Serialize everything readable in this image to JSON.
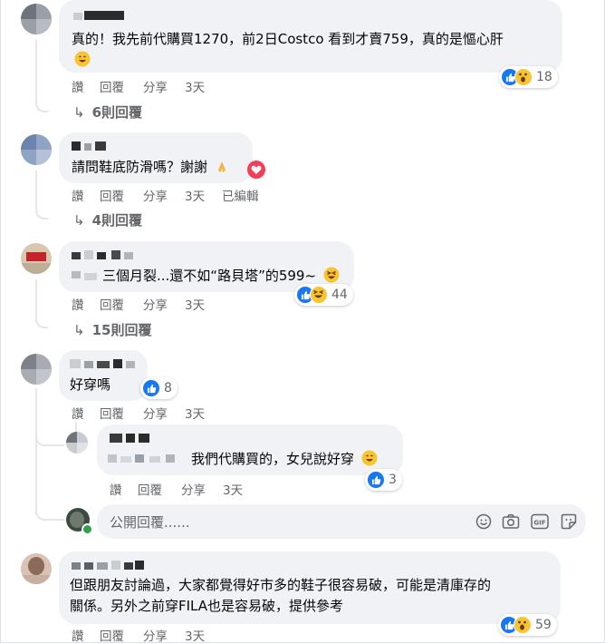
{
  "comments": [
    {
      "text_lines": [
        "真的！我先前代購買1270，前2日Costco 看到才賣759，真的是慪心肝"
      ],
      "has_emoji_line": true,
      "actions": {
        "like": "讚",
        "reply": "回覆",
        "share": "分享",
        "time": "3天"
      },
      "reactions": {
        "icons": [
          "like-icon",
          "wow-icon"
        ],
        "count": "18"
      },
      "replies_label": "6則回覆"
    },
    {
      "text_lines": [
        "請問鞋底防滑嗎？謝謝"
      ],
      "actions": {
        "like": "讚",
        "reply": "回覆",
        "share": "分享",
        "time": "3天",
        "edited": "已編輯"
      },
      "replies_label": "4則回覆"
    },
    {
      "text_lines": [
        "三個月裂...還不如“路貝塔”的599~"
      ],
      "actions": {
        "like": "讚",
        "reply": "回覆",
        "share": "分享",
        "time": "3天"
      },
      "reactions": {
        "icons": [
          "like-icon",
          "haha-icon"
        ],
        "count": "44"
      },
      "replies_label": "15則回覆"
    },
    {
      "text_lines": [
        "好穿嗎"
      ],
      "actions": {
        "like": "讚",
        "reply": "回覆",
        "share": "分享",
        "time": "3天"
      },
      "reactions": {
        "icons": [
          "like-icon"
        ],
        "count": "8"
      }
    },
    {
      "text_lines": [
        "但跟朋友討論過，大家都覺得好市多的鞋子很容易破，可能是清庫存的",
        "關係。另外之前穿FILA也是容易破，提供參考"
      ],
      "actions": {
        "like": "讚",
        "reply": "回覆",
        "share": "分享",
        "time": "3天"
      },
      "reactions": {
        "icons": [
          "like-icon",
          "wow-icon"
        ],
        "count": "59"
      }
    }
  ],
  "nested_reply": {
    "text": "我們代購買的，女兒說好穿",
    "actions": {
      "like": "讚",
      "reply": "回覆",
      "share": "分享",
      "time": "3天"
    },
    "reactions": {
      "icons": [
        "like-icon"
      ],
      "count": "3"
    }
  },
  "reply_box": {
    "placeholder": "公開回覆......",
    "tools": [
      "emoji-icon",
      "camera-icon",
      "gif-icon",
      "sticker-icon"
    ]
  },
  "colors": {
    "bubble": "#f0f2f5",
    "meta_text": "#65676b",
    "like_blue": "#1877f2",
    "reaction_yellow": "#f7c433",
    "heart_red": "#f33e58",
    "online_green": "#31a24c"
  }
}
